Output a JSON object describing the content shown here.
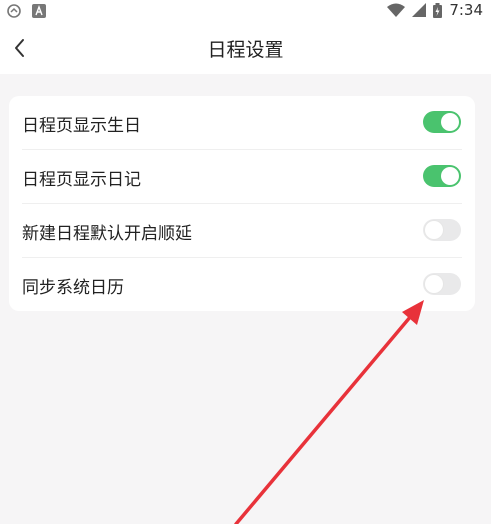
{
  "status_bar": {
    "time": "7:34",
    "left_icons": [
      "app-notification-icon",
      "a-badge-icon"
    ],
    "right_icons": [
      "wifi-icon",
      "signal-icon",
      "battery-icon"
    ]
  },
  "header": {
    "title": "日程设置",
    "back_icon": "chevron-left-icon"
  },
  "settings": {
    "items": [
      {
        "label": "日程页显示生日",
        "enabled": true
      },
      {
        "label": "日程页显示日记",
        "enabled": true
      },
      {
        "label": "新建日程默认开启顺延",
        "enabled": false
      },
      {
        "label": "同步系统日历",
        "enabled": false
      }
    ]
  },
  "colors": {
    "toggle_on": "#4ac36e",
    "toggle_off": "#e9e9ea",
    "annotation_arrow": "#e8323a",
    "background": "#f6f5f6"
  }
}
